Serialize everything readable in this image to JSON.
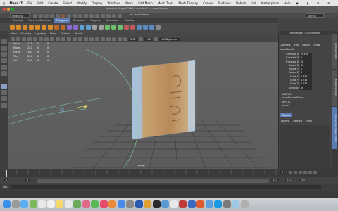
{
  "menubar": {
    "app": "Maya LT",
    "items": [
      "File",
      "Edit",
      "Create",
      "Select",
      "Modify",
      "Display",
      "Windows",
      "Mesh",
      "Edit Mesh",
      "Mesh Tools",
      "Mesh Display",
      "Curves",
      "Surfaces",
      "Deform",
      "UV",
      "Marketplace",
      "Help"
    ]
  },
  "window": {
    "title": "Autodesk Maya LT 2016 - untitled* --- waveHandle"
  },
  "toolbar": {
    "mode": "Modeling",
    "live_surface": "No Live Surface",
    "sign_in": "Sign In"
  },
  "shelf_tabs": [
    "General",
    "Curves / Surfaces",
    "Polygons",
    "Sculpting",
    "Rigging",
    "Animation",
    "Shading"
  ],
  "active_shelf": "Polygons",
  "viewport_menu": [
    "View",
    "Shading",
    "Lighting",
    "Show",
    "Options",
    "Panels"
  ],
  "viewport_fields": {
    "val1": "0.00",
    "val2": "1.00",
    "colorspace": "sRGB gamma"
  },
  "hud": [
    {
      "k": "Verts",
      "v1": "121",
      "v2": "0",
      "v3": "0"
    },
    {
      "k": "Edges",
      "v1": "220",
      "v2": "0",
      "v3": "0"
    },
    {
      "k": "Faces",
      "v1": "100",
      "v2": "0",
      "v3": "0"
    },
    {
      "k": "Tris",
      "v1": "200",
      "v2": "0",
      "v3": "0"
    },
    {
      "k": "UVs",
      "v1": "121",
      "v2": "0",
      "v3": "0"
    }
  ],
  "camera_label": "persp",
  "channel_box": {
    "title": "Channel Box / Layer Editor",
    "menus": [
      "Channels",
      "Edit",
      "Object",
      "Show"
    ],
    "object": "waveHandle",
    "attributes": [
      {
        "name": "Translate X",
        "value": "-9.158"
      },
      {
        "name": "Translate Y",
        "value": "0"
      },
      {
        "name": "Translate Z",
        "value": "-0"
      },
      {
        "name": "Rotate X",
        "value": "90"
      },
      {
        "name": "Rotate Y",
        "value": "0"
      },
      {
        "name": "Rotate Z",
        "value": "0"
      },
      {
        "name": "Scale X",
        "value": "4.731"
      },
      {
        "name": "Scale Y",
        "value": "4.731"
      },
      {
        "name": "Scale Z",
        "value": "4.731"
      },
      {
        "name": "Visibility",
        "value": "on"
      }
    ],
    "shapes_label": "SHAPES",
    "shape_name": "waveHandleShape",
    "inputs_label": "INPUTS",
    "input_name": "wave1"
  },
  "layer_editor": {
    "tab": "Display",
    "menus": [
      "Layers",
      "Options",
      "Help"
    ]
  },
  "side_tabs": [
    "Attribute Editor",
    "Modeling Toolkit",
    "Channel Box / Layer Editor"
  ],
  "timeline": {
    "ticks": [
      "1",
      "5",
      "10",
      "15",
      "20",
      "25",
      "30",
      "35",
      "40",
      "45",
      "50",
      "55",
      "60",
      "65",
      "70",
      "75",
      "80",
      "85",
      "90",
      "95",
      "100",
      "105",
      "110",
      "115",
      "120"
    ],
    "current": "1"
  },
  "range": {
    "start": "1",
    "start2": "1",
    "end": "120",
    "end2": "120",
    "end3": "200",
    "fps_start": "1"
  },
  "command_line": {
    "label": "MEL"
  },
  "colors": {
    "shelf_active": "#5b7bb5",
    "viewport": "#606060",
    "curve": "#7fd0a0",
    "grid": "#222222"
  }
}
